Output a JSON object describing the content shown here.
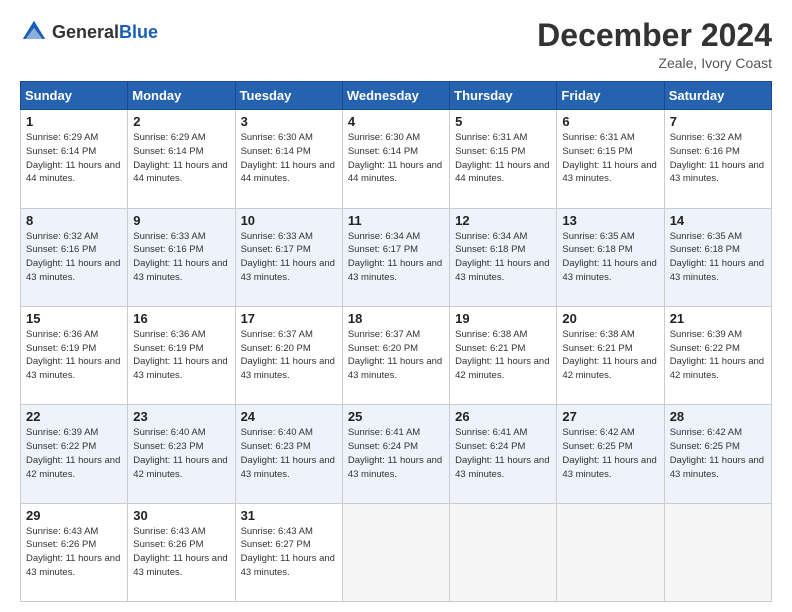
{
  "header": {
    "logo_general": "General",
    "logo_blue": "Blue",
    "month_title": "December 2024",
    "subtitle": "Zeale, Ivory Coast"
  },
  "weekdays": [
    "Sunday",
    "Monday",
    "Tuesday",
    "Wednesday",
    "Thursday",
    "Friday",
    "Saturday"
  ],
  "weeks": [
    [
      {
        "day": 1,
        "sunrise": "6:29 AM",
        "sunset": "6:14 PM",
        "daylight": "11 hours and 44 minutes."
      },
      {
        "day": 2,
        "sunrise": "6:29 AM",
        "sunset": "6:14 PM",
        "daylight": "11 hours and 44 minutes."
      },
      {
        "day": 3,
        "sunrise": "6:30 AM",
        "sunset": "6:14 PM",
        "daylight": "11 hours and 44 minutes."
      },
      {
        "day": 4,
        "sunrise": "6:30 AM",
        "sunset": "6:14 PM",
        "daylight": "11 hours and 44 minutes."
      },
      {
        "day": 5,
        "sunrise": "6:31 AM",
        "sunset": "6:15 PM",
        "daylight": "11 hours and 44 minutes."
      },
      {
        "day": 6,
        "sunrise": "6:31 AM",
        "sunset": "6:15 PM",
        "daylight": "11 hours and 43 minutes."
      },
      {
        "day": 7,
        "sunrise": "6:32 AM",
        "sunset": "6:16 PM",
        "daylight": "11 hours and 43 minutes."
      }
    ],
    [
      {
        "day": 8,
        "sunrise": "6:32 AM",
        "sunset": "6:16 PM",
        "daylight": "11 hours and 43 minutes."
      },
      {
        "day": 9,
        "sunrise": "6:33 AM",
        "sunset": "6:16 PM",
        "daylight": "11 hours and 43 minutes."
      },
      {
        "day": 10,
        "sunrise": "6:33 AM",
        "sunset": "6:17 PM",
        "daylight": "11 hours and 43 minutes."
      },
      {
        "day": 11,
        "sunrise": "6:34 AM",
        "sunset": "6:17 PM",
        "daylight": "11 hours and 43 minutes."
      },
      {
        "day": 12,
        "sunrise": "6:34 AM",
        "sunset": "6:18 PM",
        "daylight": "11 hours and 43 minutes."
      },
      {
        "day": 13,
        "sunrise": "6:35 AM",
        "sunset": "6:18 PM",
        "daylight": "11 hours and 43 minutes."
      },
      {
        "day": 14,
        "sunrise": "6:35 AM",
        "sunset": "6:18 PM",
        "daylight": "11 hours and 43 minutes."
      }
    ],
    [
      {
        "day": 15,
        "sunrise": "6:36 AM",
        "sunset": "6:19 PM",
        "daylight": "11 hours and 43 minutes."
      },
      {
        "day": 16,
        "sunrise": "6:36 AM",
        "sunset": "6:19 PM",
        "daylight": "11 hours and 43 minutes."
      },
      {
        "day": 17,
        "sunrise": "6:37 AM",
        "sunset": "6:20 PM",
        "daylight": "11 hours and 43 minutes."
      },
      {
        "day": 18,
        "sunrise": "6:37 AM",
        "sunset": "6:20 PM",
        "daylight": "11 hours and 43 minutes."
      },
      {
        "day": 19,
        "sunrise": "6:38 AM",
        "sunset": "6:21 PM",
        "daylight": "11 hours and 42 minutes."
      },
      {
        "day": 20,
        "sunrise": "6:38 AM",
        "sunset": "6:21 PM",
        "daylight": "11 hours and 42 minutes."
      },
      {
        "day": 21,
        "sunrise": "6:39 AM",
        "sunset": "6:22 PM",
        "daylight": "11 hours and 42 minutes."
      }
    ],
    [
      {
        "day": 22,
        "sunrise": "6:39 AM",
        "sunset": "6:22 PM",
        "daylight": "11 hours and 42 minutes."
      },
      {
        "day": 23,
        "sunrise": "6:40 AM",
        "sunset": "6:23 PM",
        "daylight": "11 hours and 42 minutes."
      },
      {
        "day": 24,
        "sunrise": "6:40 AM",
        "sunset": "6:23 PM",
        "daylight": "11 hours and 43 minutes."
      },
      {
        "day": 25,
        "sunrise": "6:41 AM",
        "sunset": "6:24 PM",
        "daylight": "11 hours and 43 minutes."
      },
      {
        "day": 26,
        "sunrise": "6:41 AM",
        "sunset": "6:24 PM",
        "daylight": "11 hours and 43 minutes."
      },
      {
        "day": 27,
        "sunrise": "6:42 AM",
        "sunset": "6:25 PM",
        "daylight": "11 hours and 43 minutes."
      },
      {
        "day": 28,
        "sunrise": "6:42 AM",
        "sunset": "6:25 PM",
        "daylight": "11 hours and 43 minutes."
      }
    ],
    [
      {
        "day": 29,
        "sunrise": "6:43 AM",
        "sunset": "6:26 PM",
        "daylight": "11 hours and 43 minutes."
      },
      {
        "day": 30,
        "sunrise": "6:43 AM",
        "sunset": "6:26 PM",
        "daylight": "11 hours and 43 minutes."
      },
      {
        "day": 31,
        "sunrise": "6:43 AM",
        "sunset": "6:27 PM",
        "daylight": "11 hours and 43 minutes."
      },
      null,
      null,
      null,
      null
    ]
  ]
}
